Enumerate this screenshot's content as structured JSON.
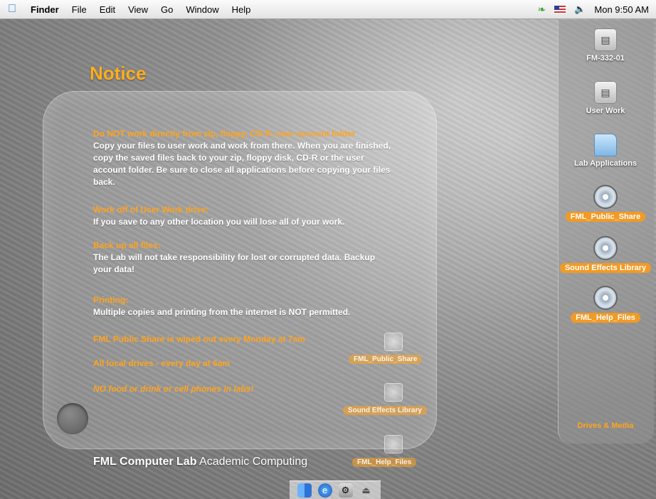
{
  "menubar": {
    "items": [
      "Finder",
      "File",
      "Edit",
      "View",
      "Go",
      "Window",
      "Help"
    ],
    "clock": "Mon 9:50 AM"
  },
  "notice": {
    "title": "Notice",
    "sections": [
      {
        "head": "Do NOT work directly from zip, floppy, CD-R, user account folder",
        "body": "Copy your files to user work and work from there.  When you are finished, copy the saved files back to your zip, floppy disk, CD-R or the user account folder. Be sure to close all applications before copying your files back."
      },
      {
        "head": "Work off of User Work drive:",
        "body": "If you save to any other location you will lose all of your work."
      },
      {
        "head": "Back up all files:",
        "body": "The Lab will not take responsibility for lost or corrupted data. Backup your data!"
      },
      {
        "head": "Printing:",
        "body": "Multiple copies and printing from the internet is NOT permitted."
      }
    ],
    "line_share": "FML Public Share is wiped out every Monday at 7am",
    "line_local": "All local drives - every day at 6am",
    "line_food": "NO food or drink or cell phones in labs!",
    "ghost_labels": [
      "FML_Public_Share",
      "Sound Effects Library",
      "FML_Help_Files"
    ]
  },
  "footer": {
    "lab": "FML Computer Lab",
    "dept": "Academic Computing"
  },
  "drawer": {
    "drives": [
      {
        "label": "FM-332-01",
        "icon": "hard-drive-icon"
      },
      {
        "label": "User Work",
        "icon": "hard-drive-icon"
      },
      {
        "label": "Lab Applications",
        "icon": "folder-icon"
      },
      {
        "label": "FML_Public_Share",
        "icon": "network-volume-icon"
      },
      {
        "label": "Sound Effects Library",
        "icon": "network-volume-icon"
      },
      {
        "label": "FML_Help_Files",
        "icon": "network-volume-icon"
      }
    ],
    "title": "Drives & Media"
  },
  "colors": {
    "accent": "#ffa41f",
    "pill": "#f29a24"
  }
}
